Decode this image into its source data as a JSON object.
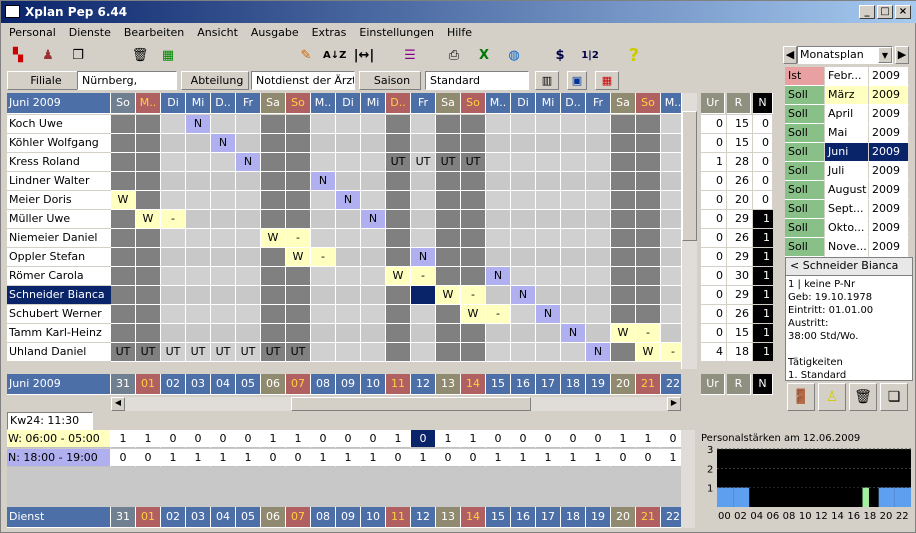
{
  "window": {
    "title": "Xplan Pep 6.44"
  },
  "menu": [
    "Personal",
    "Dienste",
    "Bearbeiten",
    "Ansicht",
    "Ausgabe",
    "Extras",
    "Einstellungen",
    "Hilfe"
  ],
  "filter": {
    "filiale_label": "Filiale",
    "filiale_value": "Nürnberg,",
    "abteilung_label": "Abteilung",
    "abteilung_value": "Notdienst der Ärzte",
    "saison_label": "Saison",
    "saison_value": "Standard"
  },
  "planview": {
    "selected": "Monatsplan"
  },
  "grid": {
    "month_label": "Juni 2009",
    "days": [
      {
        "d": "31",
        "wd": "So",
        "t": "we"
      },
      {
        "d": "01",
        "wd": "M..",
        "t": "hol"
      },
      {
        "d": "02",
        "wd": "Di",
        "t": "wk"
      },
      {
        "d": "03",
        "wd": "Mi",
        "t": "wk"
      },
      {
        "d": "04",
        "wd": "D..",
        "t": "wk"
      },
      {
        "d": "05",
        "wd": "Fr",
        "t": "wk"
      },
      {
        "d": "06",
        "wd": "Sa",
        "t": "sa"
      },
      {
        "d": "07",
        "wd": "So",
        "t": "hol"
      },
      {
        "d": "08",
        "wd": "M..",
        "t": "wk"
      },
      {
        "d": "09",
        "wd": "Di",
        "t": "wk"
      },
      {
        "d": "10",
        "wd": "Mi",
        "t": "wk"
      },
      {
        "d": "11",
        "wd": "D..",
        "t": "hol"
      },
      {
        "d": "12",
        "wd": "Fr",
        "t": "wk"
      },
      {
        "d": "13",
        "wd": "Sa",
        "t": "sa"
      },
      {
        "d": "14",
        "wd": "So",
        "t": "hol"
      },
      {
        "d": "15",
        "wd": "M..",
        "t": "wk"
      },
      {
        "d": "16",
        "wd": "Di",
        "t": "wk"
      },
      {
        "d": "17",
        "wd": "Mi",
        "t": "wk"
      },
      {
        "d": "18",
        "wd": "D..",
        "t": "wk"
      },
      {
        "d": "19",
        "wd": "Fr",
        "t": "wk"
      },
      {
        "d": "20",
        "wd": "Sa",
        "t": "sa"
      },
      {
        "d": "21",
        "wd": "So",
        "t": "hol"
      },
      {
        "d": "22",
        "wd": "M..",
        "t": "wk"
      }
    ],
    "employees": [
      {
        "name": "Koch Uwe",
        "cells": {
          "3": "N"
        },
        "ur": "0",
        "r": "15",
        "n": "0"
      },
      {
        "name": "Köhler Wolfgang",
        "cells": {
          "4": "N"
        },
        "ur": "0",
        "r": "15",
        "n": "0"
      },
      {
        "name": "Kress Roland",
        "cells": {
          "5": "N",
          "11": "UT",
          "12": "UT",
          "13": "UT",
          "14": "UT"
        },
        "ur": "1",
        "r": "28",
        "n": "0"
      },
      {
        "name": "Lindner Walter",
        "cells": {
          "8": "N"
        },
        "ur": "0",
        "r": "26",
        "n": "0"
      },
      {
        "name": "Meier Doris",
        "cells": {
          "0": "W",
          "9": "N"
        },
        "ur": "0",
        "r": "20",
        "n": "0"
      },
      {
        "name": "Müller Uwe",
        "cells": {
          "1": "W",
          "2": "-",
          "10": "N"
        },
        "ur": "0",
        "r": "29",
        "n": "1"
      },
      {
        "name": "Niemeier Daniel",
        "cells": {
          "6": "W",
          "7": "-"
        },
        "ur": "0",
        "r": "26",
        "n": "1"
      },
      {
        "name": "Oppler Stefan",
        "cells": {
          "7": "W",
          "8": "-",
          "12": "N"
        },
        "ur": "0",
        "r": "29",
        "n": "1"
      },
      {
        "name": "Römer Carola",
        "cells": {
          "11": "W",
          "12": "-",
          "15": "N"
        },
        "ur": "0",
        "r": "30",
        "n": "1"
      },
      {
        "name": "Schneider Bianca",
        "cells": {
          "12": "",
          "13": "W",
          "14": "-",
          "16": "N"
        },
        "ur": "0",
        "r": "29",
        "n": "1",
        "selected": true
      },
      {
        "name": "Schubert Werner",
        "cells": {
          "14": "W",
          "15": "-",
          "17": "N"
        },
        "ur": "0",
        "r": "26",
        "n": "1"
      },
      {
        "name": "Tamm Karl-Heinz",
        "cells": {
          "18": "N",
          "20": "W",
          "21": "-"
        },
        "ur": "0",
        "r": "15",
        "n": "1"
      },
      {
        "name": "Uhland Daniel",
        "cells": {
          "0": "UT",
          "1": "UT",
          "2": "UT",
          "3": "UT",
          "4": "UT",
          "5": "UT",
          "6": "UT",
          "7": "UT",
          "19": "N",
          "21": "W",
          "22": "-"
        },
        "ur": "4",
        "r": "18",
        "n": "1"
      }
    ],
    "col_ur": "Ur",
    "col_r": "R",
    "col_n": "N"
  },
  "months": [
    {
      "status": "Ist",
      "month": "Febr...",
      "year": "2009"
    },
    {
      "status": "Soll",
      "month": "März",
      "year": "2009"
    },
    {
      "status": "Soll",
      "month": "April",
      "year": "2009"
    },
    {
      "status": "Soll",
      "month": "Mai",
      "year": "2009"
    },
    {
      "status": "Soll",
      "month": "Juni",
      "year": "2009",
      "selected": true
    },
    {
      "status": "Soll",
      "month": "Juli",
      "year": "2009"
    },
    {
      "status": "Soll",
      "month": "August",
      "year": "2009"
    },
    {
      "status": "Soll",
      "month": "Sept...",
      "year": "2009"
    },
    {
      "status": "Soll",
      "month": "Okto...",
      "year": "2009"
    },
    {
      "status": "Soll",
      "month": "Nove...",
      "year": "2009"
    }
  ],
  "employee_info": {
    "name": "Schneider Bianca",
    "lines": [
      "1 | keine P-Nr",
      "Geb: 19.10.1978",
      "Eintritt: 01.01.00",
      "Austritt:",
      "38:00 Std/Wo.",
      "",
      "Tätigkeiten",
      "1. Standard"
    ]
  },
  "bottom": {
    "kw": "Kw24: 11:30",
    "shifts": [
      {
        "label": "W: 06:00 - 05:00",
        "values": [
          "1",
          "1",
          "0",
          "0",
          "0",
          "0",
          "1",
          "1",
          "0",
          "0",
          "0",
          "1",
          "0",
          "1",
          "1",
          "0",
          "0",
          "0",
          "0",
          "0",
          "1",
          "1",
          "0"
        ],
        "sel": 12
      },
      {
        "label": "N: 18:00 - 19:00",
        "values": [
          "0",
          "0",
          "1",
          "1",
          "1",
          "1",
          "0",
          "0",
          "1",
          "1",
          "1",
          "0",
          "1",
          "0",
          "0",
          "1",
          "1",
          "1",
          "1",
          "1",
          "0",
          "0",
          "1"
        ]
      }
    ],
    "dienst_label": "Dienst"
  },
  "staff_chart": {
    "title": "Personalstärken am 12.06.2009",
    "yticks": [
      "3",
      "2",
      "1"
    ],
    "xticks": [
      "00",
      "02",
      "04",
      "06",
      "08",
      "10",
      "12",
      "14",
      "16",
      "18",
      "20",
      "22"
    ]
  },
  "chart_data": {
    "type": "bar",
    "title": "Personalstärken am 12.06.2009",
    "x": [
      "00",
      "02",
      "04",
      "06",
      "08",
      "10",
      "12",
      "14",
      "16",
      "18",
      "20",
      "22"
    ],
    "series": [
      {
        "values": [
          1,
          1,
          1,
          1,
          1,
          1,
          1,
          1,
          1,
          1,
          1,
          1
        ]
      }
    ],
    "ylim": [
      0,
      3
    ]
  },
  "colors": {
    "header": "#4c6fa8",
    "holiday": "#b07070",
    "saturday": "#908070",
    "night": "#b0b0f0",
    "day": "#ffffc0"
  }
}
